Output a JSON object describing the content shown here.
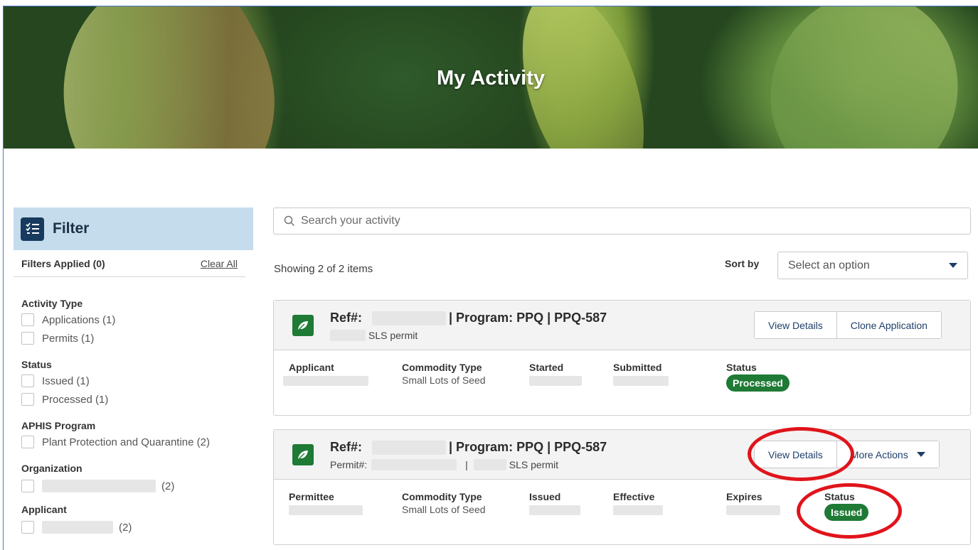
{
  "hero": {
    "title": "My Activity"
  },
  "sidebar": {
    "title": "Filter",
    "filters_applied": "Filters Applied (0)",
    "clear_all": "Clear All",
    "groups": [
      {
        "heading": "Activity Type",
        "items": [
          "Applications (1)",
          "Permits (1)"
        ]
      },
      {
        "heading": "Status",
        "items": [
          "Issued (1)",
          "Processed (1)"
        ]
      },
      {
        "heading": "APHIS Program",
        "items": [
          "Plant Protection and Quarantine (2)"
        ]
      },
      {
        "heading": "Organization",
        "items": [
          "(2)"
        ]
      },
      {
        "heading": "Applicant",
        "items": [
          "(2)"
        ]
      }
    ]
  },
  "search": {
    "placeholder": "Search your activity"
  },
  "results": {
    "showing": "Showing 2 of 2 items"
  },
  "sort": {
    "label": "Sort by",
    "value": "Select an option"
  },
  "cards": [
    {
      "ref_label": "Ref#:",
      "program": "| Program: PPQ | PPQ-587",
      "subtitle": "SLS permit",
      "buttons": [
        "View Details",
        "Clone Application"
      ],
      "columns": [
        {
          "header": "Applicant",
          "value": ""
        },
        {
          "header": "Commodity Type",
          "value": "Small Lots of Seed"
        },
        {
          "header": "Started",
          "value": ""
        },
        {
          "header": "Submitted",
          "value": ""
        },
        {
          "header": "Status",
          "value": "Processed"
        }
      ]
    },
    {
      "ref_label": "Ref#:",
      "program": "| Program: PPQ | PPQ-587",
      "permit_label": "Permit#:",
      "separator": "|",
      "subtitle": "SLS permit",
      "buttons": [
        "View Details",
        "More Actions"
      ],
      "columns": [
        {
          "header": "Permittee",
          "value": ""
        },
        {
          "header": "Commodity Type",
          "value": "Small Lots of Seed"
        },
        {
          "header": "Issued",
          "value": ""
        },
        {
          "header": "Effective",
          "value": ""
        },
        {
          "header": "Expires",
          "value": ""
        },
        {
          "header": "Status",
          "value": "Issued"
        }
      ]
    }
  ],
  "colors": {
    "brand_green": "#1e7a35",
    "filter_header": "#c5dced",
    "link_navy": "#1f3f69",
    "annotation_red": "#e0141b"
  }
}
